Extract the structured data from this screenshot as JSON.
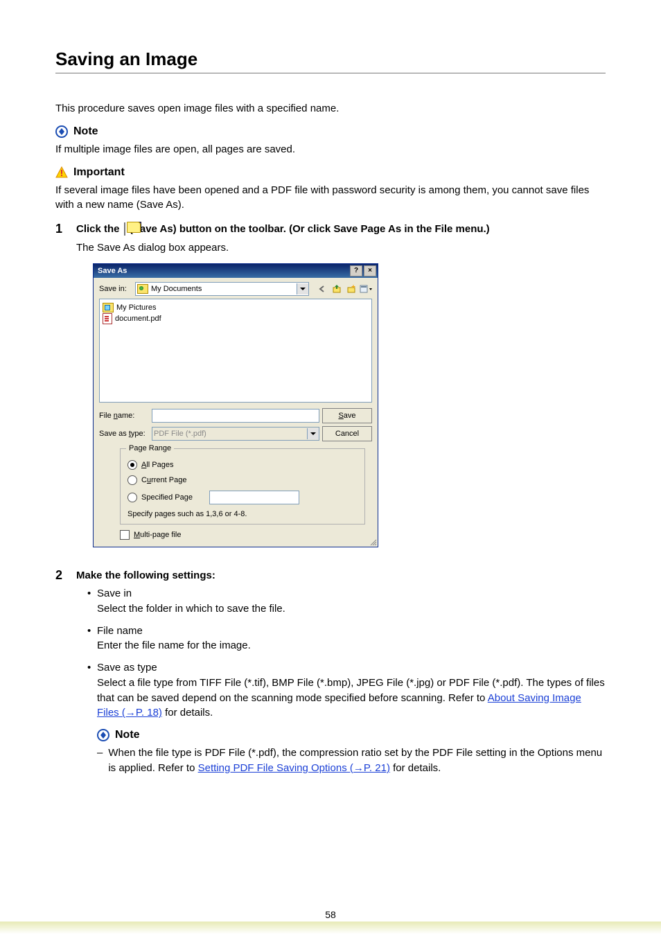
{
  "title": "Saving an Image",
  "intro": "This procedure saves open image files with a specified name.",
  "note_label": "Note",
  "note_text": "If multiple image files are open, all pages are saved.",
  "important_label": "Important",
  "important_text": "If several image files have been opened and a PDF file with password security is among them, you cannot save files with a new name (Save As).",
  "step1": {
    "num": "1",
    "pre": "Click the ",
    "post": " (Save As) button on the toolbar. (Or click Save Page As in the File menu.)",
    "sub": "The Save As dialog box appears."
  },
  "dialog": {
    "title": "Save As",
    "save_in_label": "Save in:",
    "save_in_value": "My Documents",
    "files": {
      "pictures": "My Pictures",
      "document": "document.pdf"
    },
    "file_name_label": "File name:",
    "file_name_value": "",
    "save_as_type_label": "Save as type:",
    "save_as_type_value": "PDF File (*.pdf)",
    "save_btn": "Save",
    "cancel_btn": "Cancel",
    "page_range": {
      "legend": "Page Range",
      "all": "All Pages",
      "current": "Current Page",
      "specified": "Specified Page",
      "specified_value": "",
      "hint": "Specify pages such as 1,3,6 or 4-8."
    },
    "multi_page": "Multi-page file"
  },
  "step2": {
    "num": "2",
    "main": "Make the following settings:",
    "bullets": [
      {
        "title": "Save in",
        "body": "Select the folder in which to save the file."
      },
      {
        "title": "File name",
        "body": "Enter the file name for the image."
      },
      {
        "title": "Save as type",
        "body_pre": "Select a file type from TIFF File (*.tif), BMP File (*.bmp), JPEG File (*.jpg) or PDF File (*.pdf). The types of files that can be saved depend on the scanning mode specified before scanning. Refer to ",
        "link1": "About Saving Image Files (→P. 18)",
        "body_post": " for details."
      }
    ],
    "note_label": "Note",
    "sub_note_pre": "When the file type is PDF File (*.pdf), the compression ratio set by the PDF File setting in the Options menu is applied. Refer to ",
    "sub_note_link": "Setting PDF File Saving Options (→P. 21)",
    "sub_note_post": "  for details."
  },
  "page_number": "58"
}
